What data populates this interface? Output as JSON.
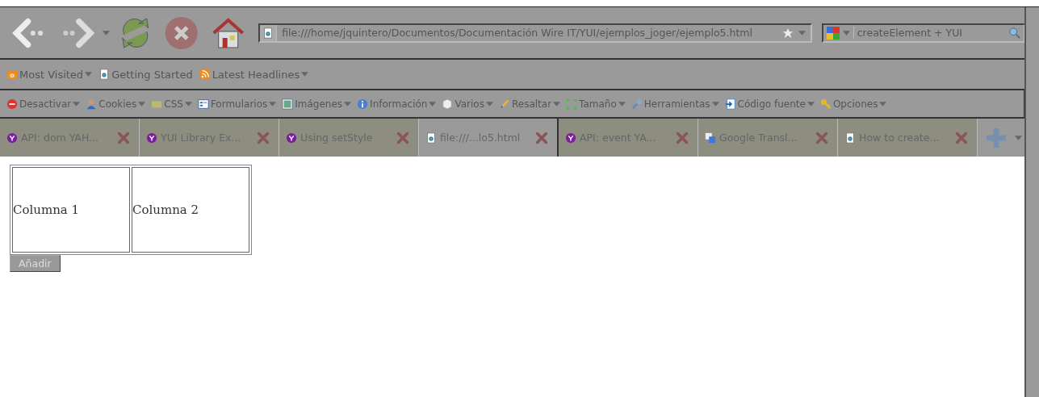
{
  "navigation": {
    "url": "file:///home/jquintero/Documentos/Documentación Wire IT/YUI/ejemplos_joger/ejemplo5.html",
    "search_value": "createElement + YUI"
  },
  "bookmarks": [
    {
      "label": "Most Visited",
      "dropdown": true
    },
    {
      "label": "Getting Started",
      "dropdown": false
    },
    {
      "label": "Latest Headlines",
      "dropdown": true
    }
  ],
  "developer_toolbar": [
    "Desactivar",
    "Cookies",
    "CSS",
    "Formularios",
    "Imágenes",
    "Información",
    "Varios",
    "Resaltar",
    "Tamaño",
    "Herramientas",
    "Código fuente",
    "Opciones"
  ],
  "tabs": [
    {
      "label": "API: dom YAH...",
      "selected": false
    },
    {
      "label": "YUI Library Ex...",
      "selected": false
    },
    {
      "label": "Using setStyle",
      "selected": false
    },
    {
      "label": "file:///...lo5.html",
      "selected": true
    },
    {
      "label": "API: event YA...",
      "selected": false
    },
    {
      "label": "Google Transl...",
      "selected": false
    },
    {
      "label": "How to create...",
      "selected": false
    }
  ],
  "table": {
    "cells": [
      "Columna 1",
      "Columna 2"
    ]
  },
  "button": "Añadir"
}
